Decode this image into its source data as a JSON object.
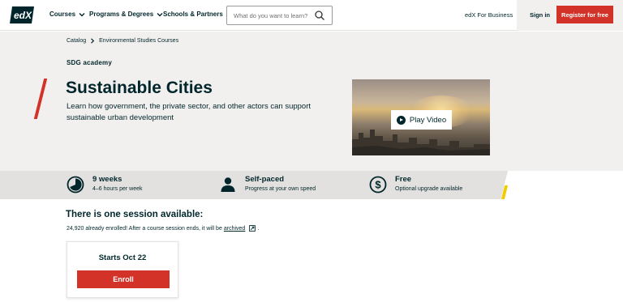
{
  "header": {
    "logo_text": "edX",
    "nav": [
      {
        "label": "Courses",
        "has_dropdown": true
      },
      {
        "label": "Programs & Degrees",
        "has_dropdown": true
      },
      {
        "label": "Schools & Partners",
        "has_dropdown": false
      }
    ],
    "search_placeholder": "What do you want to learn?",
    "business_link": "edX For Business",
    "sign_in": "Sign in",
    "register": "Register for free"
  },
  "breadcrumb": {
    "items": [
      "Catalog",
      "Environmental Studies Courses"
    ]
  },
  "course": {
    "partner_logo": "SDG academy",
    "title": "Sustainable Cities",
    "description": "Learn how government, the private sector, and other actors can support sustainable urban development",
    "video_button": "Play Video"
  },
  "stats": [
    {
      "icon": "clock-icon",
      "title": "9 weeks",
      "subtitle": "4–6 hours per week"
    },
    {
      "icon": "person-icon",
      "title": "Self-paced",
      "subtitle": "Progress at your own speed"
    },
    {
      "icon": "dollar-icon",
      "title": "Free",
      "subtitle": "Optional upgrade available"
    }
  ],
  "session": {
    "heading": "There is one session available:",
    "enrolled_text": "24,920 already enrolled! After a course session ends, it will be",
    "archived_link": "archived",
    "trailing": ".",
    "card_title": "Starts Oct 22",
    "enroll_button": "Enroll"
  },
  "colors": {
    "brand_red": "#d23228",
    "text_dark": "#00262b",
    "hero_bg": "#f2f0ef",
    "stats_bg": "#e3e1df",
    "accent_yellow": "#f0cc00"
  }
}
